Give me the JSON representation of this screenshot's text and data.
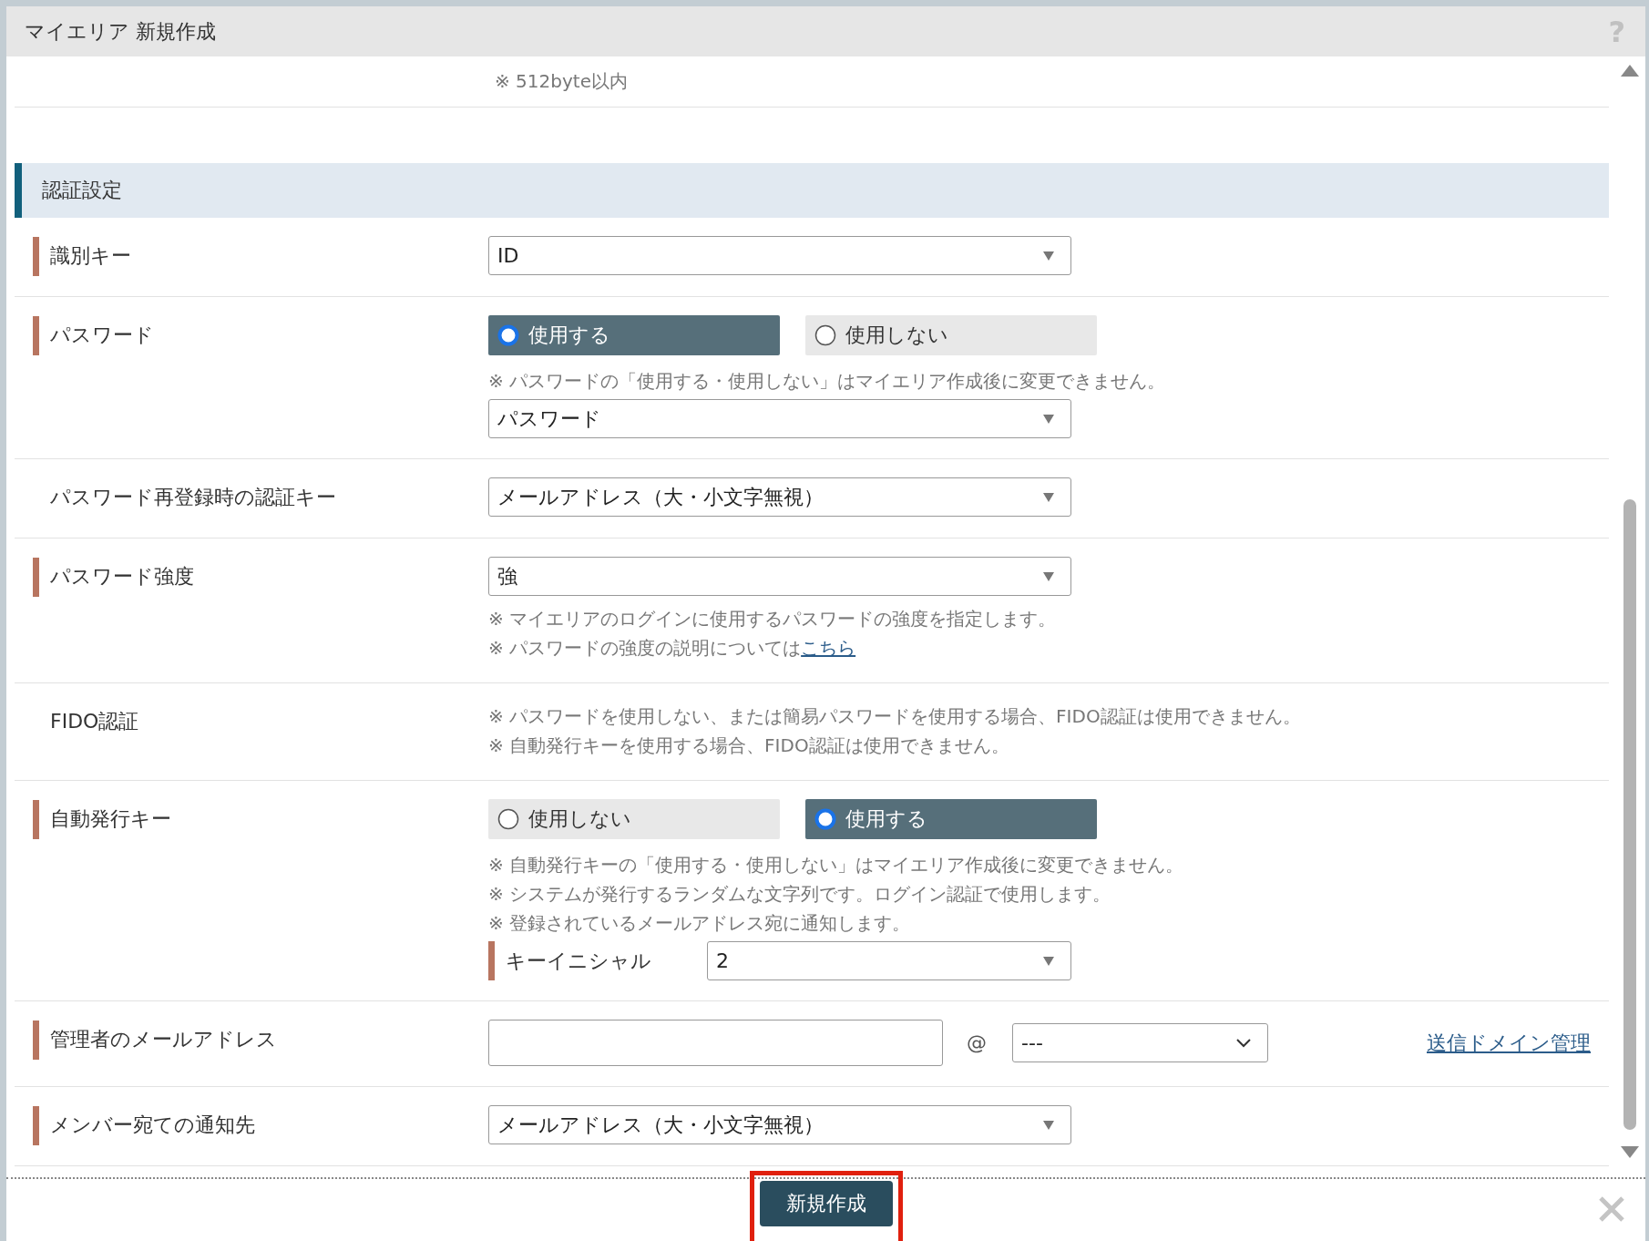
{
  "dialog": {
    "title": "マイエリア 新規作成",
    "help": "?"
  },
  "top_note": "※ 512byte以内",
  "section": {
    "title": "認証設定"
  },
  "rows": [
    {
      "label": "識別キー",
      "required": true,
      "fields": [
        {
          "kind": "select",
          "value": "ID"
        }
      ]
    },
    {
      "label": "パスワード",
      "required": true,
      "fields": [
        {
          "kind": "radios",
          "options": [
            {
              "label": "使用する",
              "selected": true
            },
            {
              "label": "使用しない",
              "selected": false
            }
          ]
        },
        {
          "kind": "notes",
          "lines": [
            {
              "text": "※ パスワードの「使用する・使用しない」はマイエリア作成後に変更できません。"
            }
          ]
        },
        {
          "kind": "select",
          "value": "パスワード"
        }
      ]
    },
    {
      "label": "パスワード再登録時の認証キー",
      "required": false,
      "fields": [
        {
          "kind": "select",
          "value": "メールアドレス（大・小文字無視）"
        }
      ]
    },
    {
      "label": "パスワード強度",
      "required": true,
      "fields": [
        {
          "kind": "select",
          "value": "強"
        },
        {
          "kind": "notes",
          "lines": [
            {
              "text": "※ マイエリアのログインに使用するパスワードの強度を指定します。"
            },
            {
              "text": "※ パスワードの強度の説明については",
              "link": "こちら"
            }
          ]
        }
      ]
    },
    {
      "label": "FIDO認証",
      "required": false,
      "fields": [
        {
          "kind": "notes",
          "lines": [
            {
              "text": "※ パスワードを使用しない、または簡易パスワードを使用する場合、FIDO認証は使用できません。"
            },
            {
              "text": "※ 自動発行キーを使用する場合、FIDO認証は使用できません。"
            }
          ]
        }
      ]
    },
    {
      "label": "自動発行キー",
      "required": true,
      "fields": [
        {
          "kind": "radios",
          "options": [
            {
              "label": "使用しない",
              "selected": false
            },
            {
              "label": "使用する",
              "selected": true
            }
          ]
        },
        {
          "kind": "notes",
          "lines": [
            {
              "text": "※ 自動発行キーの「使用する・使用しない」はマイエリア作成後に変更できません。"
            },
            {
              "text": "※ システムが発行するランダムな文字列です。ログイン認証で使用します。"
            },
            {
              "text": "※ 登録されているメールアドレス宛に通知します。"
            }
          ]
        },
        {
          "kind": "subselect",
          "label": "キーイニシャル",
          "required": true,
          "value": "2"
        }
      ]
    },
    {
      "label": "管理者のメールアドレス",
      "required": true,
      "fields": [
        {
          "kind": "email",
          "at": "@",
          "domain": "---",
          "link": "送信ドメイン管理"
        }
      ]
    },
    {
      "label": "メンバー宛ての通知先",
      "required": true,
      "fields": [
        {
          "kind": "select",
          "value": "メールアドレス（大・小文字無視）"
        }
      ]
    }
  ],
  "footer": {
    "submit": "新規作成",
    "highlighted": true
  }
}
